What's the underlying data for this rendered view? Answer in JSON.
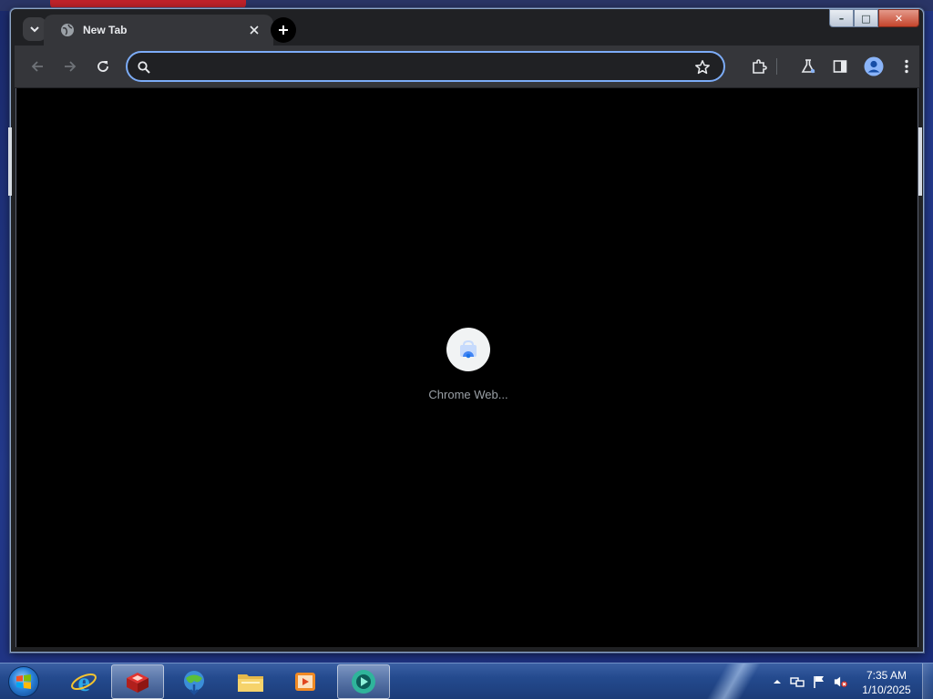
{
  "browser": {
    "tab": {
      "title": "New Tab"
    },
    "omnibox": {
      "value": "",
      "placeholder": ""
    },
    "loading": {
      "label": "Chrome Web..."
    }
  },
  "caption_buttons": {
    "minimize": "–",
    "maximize": "□",
    "close": "✕"
  },
  "taskbar": {
    "apps": [
      {
        "name": "internet-explorer"
      },
      {
        "name": "red-app",
        "active": true
      },
      {
        "name": "internet-download-manager"
      },
      {
        "name": "file-explorer"
      },
      {
        "name": "media-player"
      },
      {
        "name": "chrome-app",
        "active": true
      }
    ],
    "clock": {
      "time": "7:35 AM",
      "date": "1/10/2025"
    }
  }
}
